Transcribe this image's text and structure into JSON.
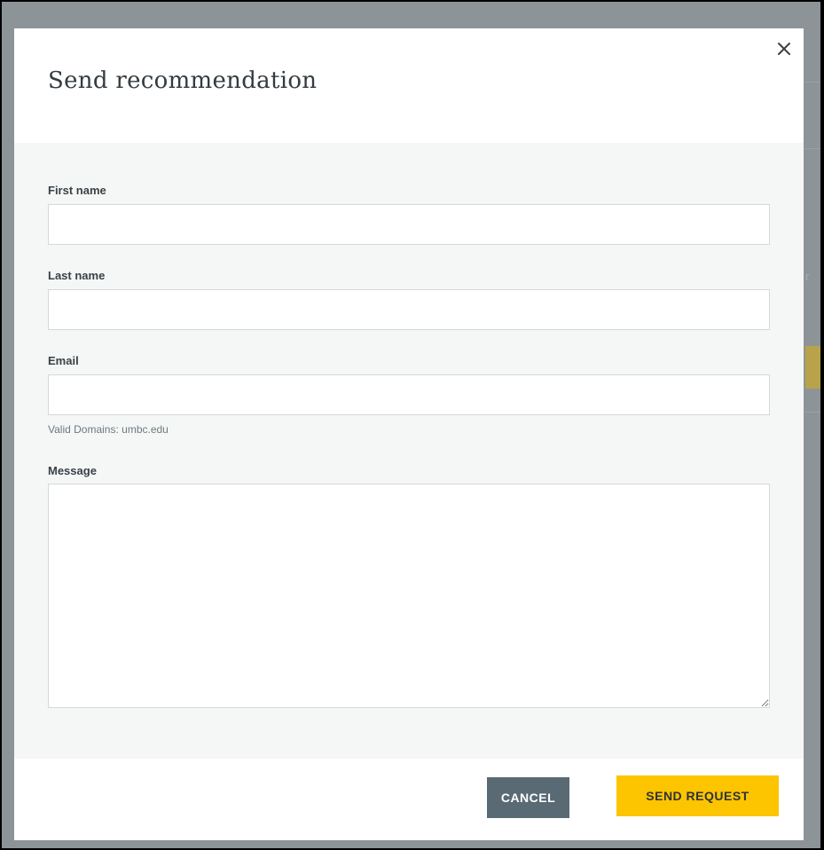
{
  "modal": {
    "title": "Send recommendation",
    "close_icon": "close-icon"
  },
  "form": {
    "first_name": {
      "label": "First name",
      "value": "",
      "placeholder": ""
    },
    "last_name": {
      "label": "Last name",
      "value": "",
      "placeholder": ""
    },
    "email": {
      "label": "Email",
      "value": "",
      "placeholder": "",
      "help_text": "Valid Domains: umbc.edu"
    },
    "message": {
      "label": "Message",
      "value": "",
      "placeholder": ""
    }
  },
  "footer": {
    "cancel_label": "CANCEL",
    "send_label": "SEND REQUEST"
  },
  "colors": {
    "primary_button": "#fdc400",
    "secondary_button": "#5a6a74",
    "backdrop": "#8d9498",
    "body_background": "#f5f7f6"
  }
}
